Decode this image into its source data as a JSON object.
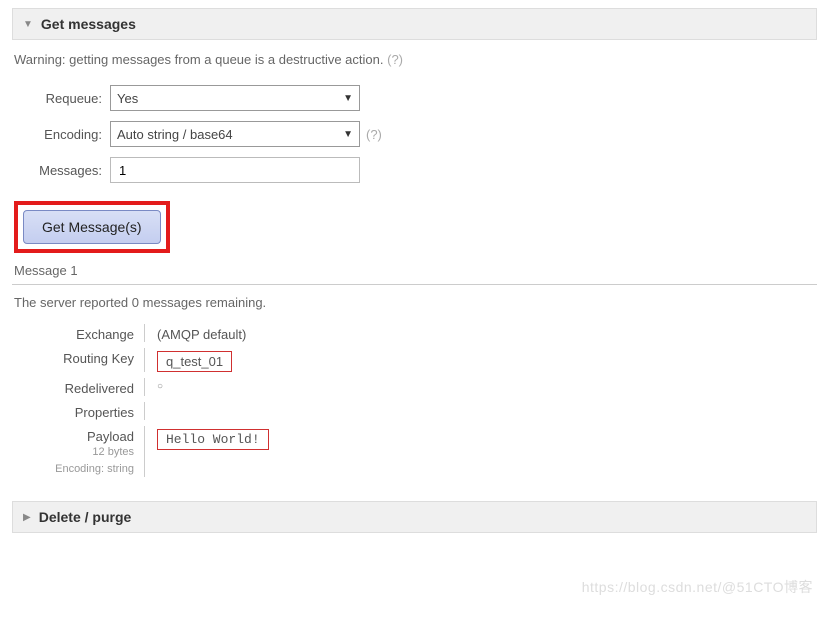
{
  "section": {
    "title": "Get messages",
    "warning": "Warning: getting messages from a queue is a destructive action.",
    "help": "(?)"
  },
  "form": {
    "requeue_label": "Requeue:",
    "requeue_value": "Yes",
    "encoding_label": "Encoding:",
    "encoding_value": "Auto string / base64",
    "encoding_help": "(?)",
    "messages_label": "Messages:",
    "messages_value": "1",
    "button_label": "Get Message(s)"
  },
  "result": {
    "message_title": "Message 1",
    "remaining": "The server reported 0 messages remaining.",
    "exchange_label": "Exchange",
    "exchange_value": "(AMQP default)",
    "routing_key_label": "Routing Key",
    "routing_key_value": "q_test_01",
    "redelivered_label": "Redelivered",
    "redelivered_value": "○",
    "properties_label": "Properties",
    "payload_label": "Payload",
    "payload_value": "Hello World!",
    "payload_size": "12 bytes",
    "payload_encoding": "Encoding: string"
  },
  "section2": {
    "title": "Delete / purge"
  },
  "watermark": "https://blog.csdn.net/@51CTO博客"
}
